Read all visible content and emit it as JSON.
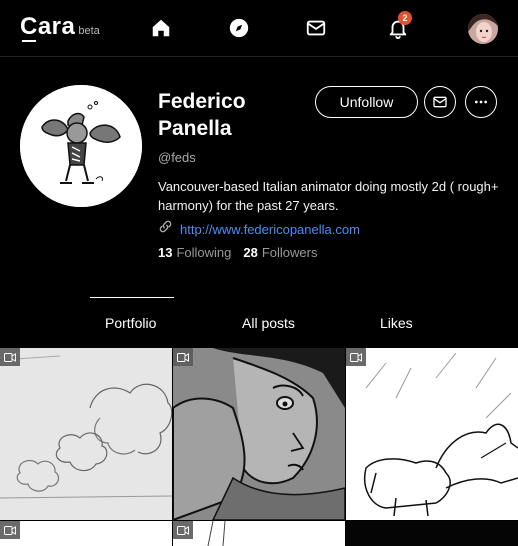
{
  "logo": {
    "text": "Cara",
    "beta": "beta"
  },
  "nav": {
    "icons": [
      "home-icon",
      "compass-icon",
      "mail-icon",
      "bell-icon"
    ],
    "notification_count": "2"
  },
  "profile": {
    "name": "Federico Panella",
    "handle": "@feds",
    "bio": "Vancouver-based Italian animator doing mostly 2d ( rough+ harmony) for the past 27 years.",
    "website": "http://www.federicopanella.com",
    "following_count": "13",
    "following_label": "Following",
    "followers_count": "28",
    "followers_label": "Followers"
  },
  "actions": {
    "unfollow_label": "Unfollow"
  },
  "tabs": [
    {
      "label": "Portfolio",
      "active": true
    },
    {
      "label": "All posts",
      "active": false
    },
    {
      "label": "Likes",
      "active": false
    }
  ],
  "colors": {
    "background": "#000000",
    "link": "#4b8df8",
    "badge": "#e2522f",
    "active_tab_underline": "#ffffff"
  }
}
